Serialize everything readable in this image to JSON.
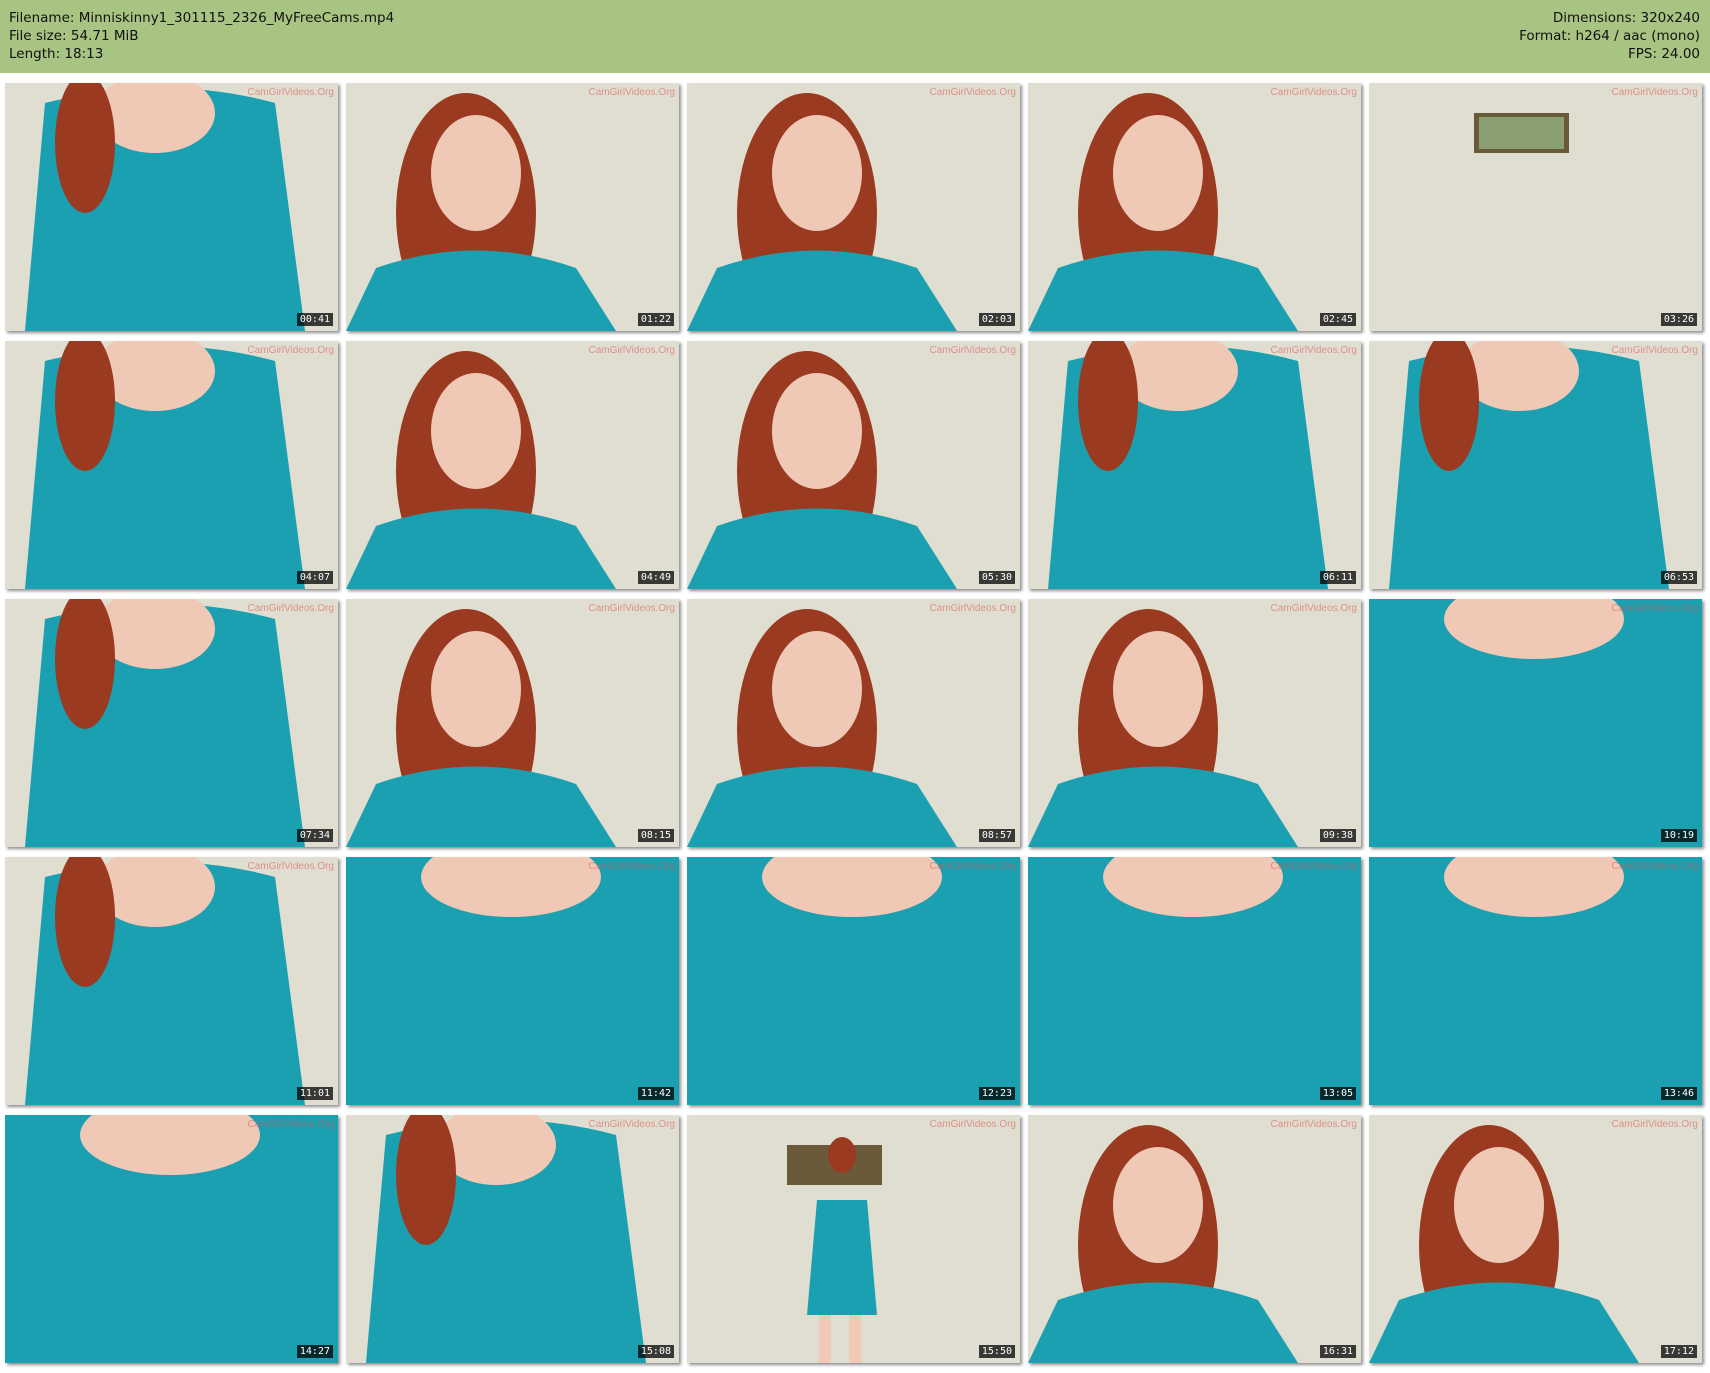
{
  "header": {
    "filename_line": "Filename: Minniskinny1_301115_2326_MyFreeCams.mp4",
    "filesize_line": "File size: 54.71 MiB",
    "length_line": "Length: 18:13",
    "dimensions_line": "Dimensions: 320x240",
    "format_line": "Format: h264 / aac (mono)",
    "fps_line": "FPS: 24.00"
  },
  "watermark_text": "CamGirlVideos.Org",
  "colors": {
    "header_bg": "#a8c482",
    "dress": "#1aa0b0",
    "wall": "#e0ded0",
    "hair": "#9a3a20",
    "skin": "#f0c8b6"
  },
  "thumbnails": [
    {
      "timestamp": "00:41",
      "scene": "torso"
    },
    {
      "timestamp": "01:22",
      "scene": "face"
    },
    {
      "timestamp": "02:03",
      "scene": "face"
    },
    {
      "timestamp": "02:45",
      "scene": "face"
    },
    {
      "timestamp": "03:26",
      "scene": "empty"
    },
    {
      "timestamp": "04:07",
      "scene": "torso"
    },
    {
      "timestamp": "04:49",
      "scene": "face"
    },
    {
      "timestamp": "05:30",
      "scene": "face"
    },
    {
      "timestamp": "06:11",
      "scene": "torso"
    },
    {
      "timestamp": "06:53",
      "scene": "torso"
    },
    {
      "timestamp": "07:34",
      "scene": "torso"
    },
    {
      "timestamp": "08:15",
      "scene": "face"
    },
    {
      "timestamp": "08:57",
      "scene": "face"
    },
    {
      "timestamp": "09:38",
      "scene": "face"
    },
    {
      "timestamp": "10:19",
      "scene": "closeup"
    },
    {
      "timestamp": "11:01",
      "scene": "torso"
    },
    {
      "timestamp": "11:42",
      "scene": "closeup"
    },
    {
      "timestamp": "12:23",
      "scene": "closeup"
    },
    {
      "timestamp": "13:05",
      "scene": "closeup"
    },
    {
      "timestamp": "13:46",
      "scene": "closeup"
    },
    {
      "timestamp": "14:27",
      "scene": "closeup"
    },
    {
      "timestamp": "15:08",
      "scene": "torso"
    },
    {
      "timestamp": "15:50",
      "scene": "full"
    },
    {
      "timestamp": "16:31",
      "scene": "face"
    },
    {
      "timestamp": "17:12",
      "scene": "face"
    }
  ]
}
